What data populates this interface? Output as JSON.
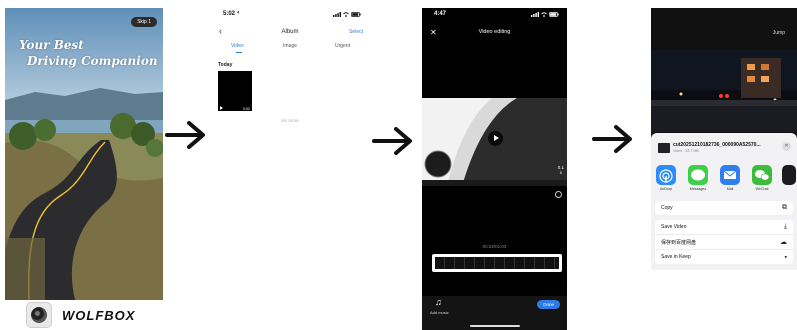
{
  "splash": {
    "skip_label": "Skip 1",
    "slogan_line1": "Your Best",
    "slogan_line2": "Driving Companion",
    "brand_name": "WOLFBOX"
  },
  "album": {
    "status_time": "5:02 ⁴",
    "title": "Album",
    "select_label": "Select",
    "tabs": [
      "Video",
      "Image",
      "Urgent"
    ],
    "active_tab": "Video",
    "section_label": "Today",
    "thumb_duration": "0:02",
    "no_more_label": "No more",
    "accent_color": "#2d7be5"
  },
  "editor": {
    "status_time": "4:47",
    "title": "Video editing",
    "speed_value": "0.1",
    "speed_unit": "x",
    "timecode": "00:02/01:03",
    "add_music_label": "Add music",
    "done_label": "Done"
  },
  "share": {
    "jump_label": "Jump",
    "file_name": "cut20251210182736_000090A52570...",
    "file_size": "Video · 53.7 MB",
    "apps": [
      {
        "name": "AirDrop",
        "icon": "airdrop-icon",
        "color": "#2f8bf5"
      },
      {
        "name": "Messages",
        "icon": "messages-icon",
        "color": "#3ecf4a"
      },
      {
        "name": "Mail",
        "icon": "mail-icon",
        "color": "#2f7ff0"
      },
      {
        "name": "WeChat",
        "icon": "wechat-icon",
        "color": "#3dbb3d"
      }
    ],
    "actions": [
      {
        "label": "Copy",
        "icon": "copy-icon"
      },
      {
        "label": "Save Video",
        "icon": "save-icon"
      },
      {
        "label": "保存到百度网盘",
        "icon": "baidu-cloud-icon"
      },
      {
        "label": "Save in Keep",
        "icon": "keep-icon"
      }
    ]
  }
}
